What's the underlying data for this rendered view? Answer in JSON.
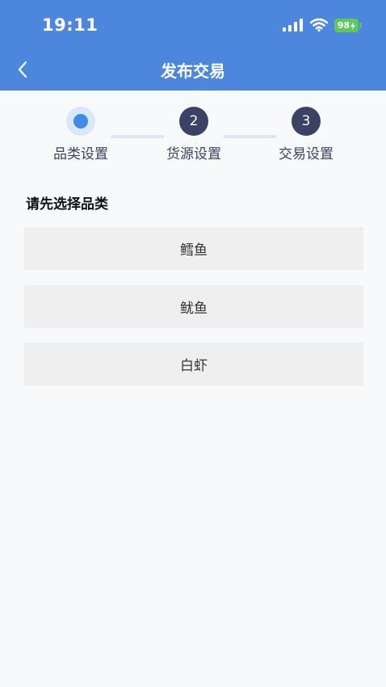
{
  "status_bar": {
    "time": "19:11",
    "battery_level": "98"
  },
  "nav": {
    "title": "发布交易"
  },
  "steps": [
    {
      "number": "1",
      "label": "品类设置",
      "state": "active"
    },
    {
      "number": "2",
      "label": "货源设置",
      "state": "pending"
    },
    {
      "number": "3",
      "label": "交易设置",
      "state": "pending"
    }
  ],
  "section": {
    "title": "请先选择品类"
  },
  "options": [
    {
      "label": "鳕鱼"
    },
    {
      "label": "鱿鱼"
    },
    {
      "label": "白虾"
    }
  ],
  "colors": {
    "header": "#4d86dd",
    "step_active": "#3f8be6",
    "step_pending": "#3b4266"
  }
}
